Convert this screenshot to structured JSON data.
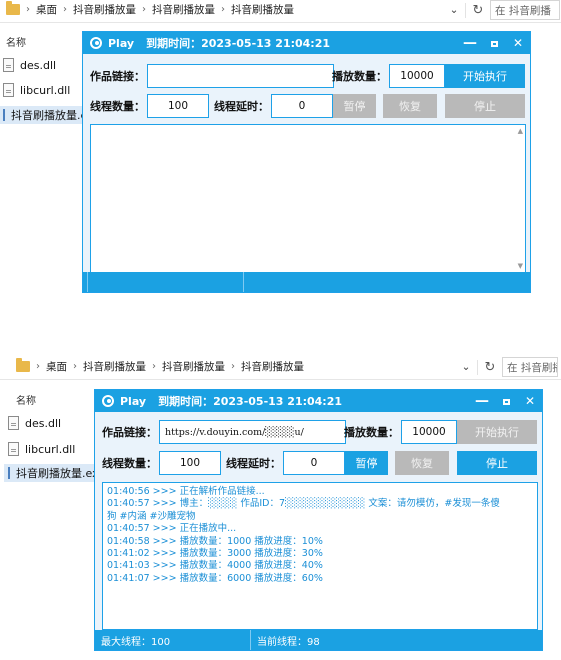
{
  "explorer_top": {
    "breadcrumb": [
      "桌面",
      "抖音刷播放量",
      "抖音刷播放量",
      "抖音刷播放量"
    ],
    "search_placeholder": "在 抖音刷播",
    "column_name": "名称",
    "files": [
      "des.dll",
      "libcurl.dll",
      "抖音刷播放量.exe"
    ]
  },
  "explorer_bottom": {
    "breadcrumb": [
      "桌面",
      "抖音刷播放量",
      "抖音刷播放量",
      "抖音刷播放量"
    ],
    "search_placeholder": "在 抖音刷播",
    "column_name": "名称",
    "files": [
      "des.dll",
      "libcurl.dll",
      "抖音刷播放量.exe"
    ]
  },
  "window_top": {
    "app_name": "Play",
    "expire": "到期时间：2023-05-13 21:04:21",
    "controls": {
      "minimize": "—",
      "maximize": "",
      "close": "✕"
    },
    "labels": {
      "link": "作品链接：",
      "play_count": "播放数量：",
      "threads": "线程数量：",
      "delay": "线程延时："
    },
    "values": {
      "link": "",
      "play_count": "10000",
      "threads": "100",
      "delay": "0"
    },
    "buttons": {
      "start": "开始执行",
      "pause": "暂停",
      "resume": "恢复",
      "stop": "停止"
    },
    "log_lines": [],
    "status": {
      "max_threads": "",
      "current_threads": ""
    }
  },
  "window_bottom": {
    "app_name": "Play",
    "expire": "到期时间：2023-05-13 21:04:21",
    "controls": {
      "minimize": "—",
      "maximize": "",
      "close": "✕"
    },
    "labels": {
      "link": "作品链接：",
      "play_count": "播放数量：",
      "threads": "线程数量：",
      "delay": "线程延时："
    },
    "values": {
      "link": "https://v.douyin.com/░░░░u/",
      "play_count": "10000",
      "threads": "100",
      "delay": "0"
    },
    "buttons": {
      "start": "开始执行",
      "pause": "暂停",
      "resume": "恢复",
      "stop": "停止"
    },
    "log_lines": [
      "01:40:56 >>> 正在解析作品链接...",
      "01:40:57 >>> 博主：░░░░  作品ID：7░░░░░░░░░░░  文案：请勿模仿，#发现一条傻",
      "狗 #内涵 #沙雕宠物",
      "01:40:57 >>> 正在播放中...",
      "01:40:58 >>> 播放数量：1000  播放进度：10%",
      "01:41:02 >>> 播放数量：3000  播放进度：30%",
      "01:41:03 >>> 播放数量：4000  播放进度：40%",
      "01:41:07 >>> 播放数量：6000  播放进度：60%"
    ],
    "status": {
      "max_threads": "最大线程：100",
      "current_threads": "当前线程：98"
    }
  },
  "colors": {
    "accent": "#1ba1e2",
    "disabled": "#b9b9b9",
    "log_text": "#1b8fd6"
  }
}
